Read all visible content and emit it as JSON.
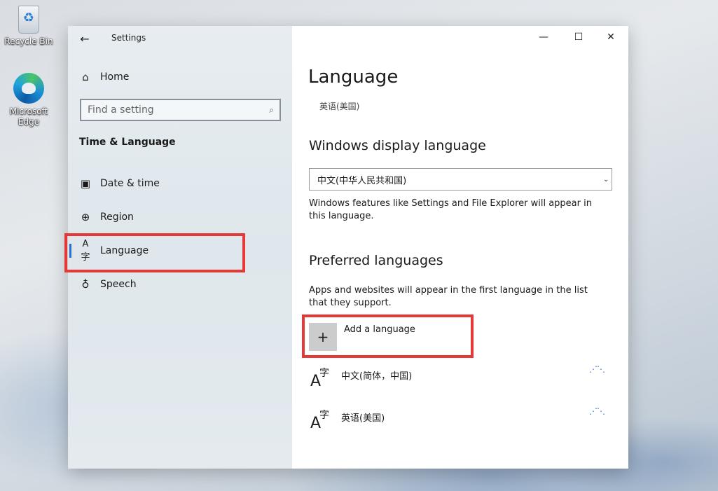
{
  "desktop": {
    "icons": [
      {
        "label": "Recycle Bin"
      },
      {
        "label": "Microsoft Edge"
      }
    ]
  },
  "window": {
    "title": "Settings",
    "captions": {
      "minimize": "—",
      "maximize": "☐",
      "close": "✕"
    }
  },
  "sidebar": {
    "home_label": "Home",
    "search_placeholder": "Find a setting",
    "section_label": "Time & Language",
    "items": [
      {
        "label": "Date & time",
        "icon": "calendar-clock-icon"
      },
      {
        "label": "Region",
        "icon": "globe-icon"
      },
      {
        "label": "Language",
        "icon": "language-icon",
        "active": true
      },
      {
        "label": "Speech",
        "icon": "microphone-icon"
      }
    ]
  },
  "main": {
    "title": "Language",
    "subtitle": "英语(美国)",
    "display_language": {
      "heading": "Windows display language",
      "selected": "中文(中华人民共和国)",
      "description": "Windows features like Settings and File Explorer will appear in this language."
    },
    "preferred": {
      "heading": "Preferred languages",
      "description": "Apps and websites will appear in the first language in the list that they support.",
      "add_label": "Add a language",
      "languages": [
        {
          "name": "中文(简体，中国)"
        },
        {
          "name": "英语(美国)"
        }
      ]
    }
  },
  "colors": {
    "accent": "#2a6ed8",
    "highlight_box": "#e53935"
  }
}
